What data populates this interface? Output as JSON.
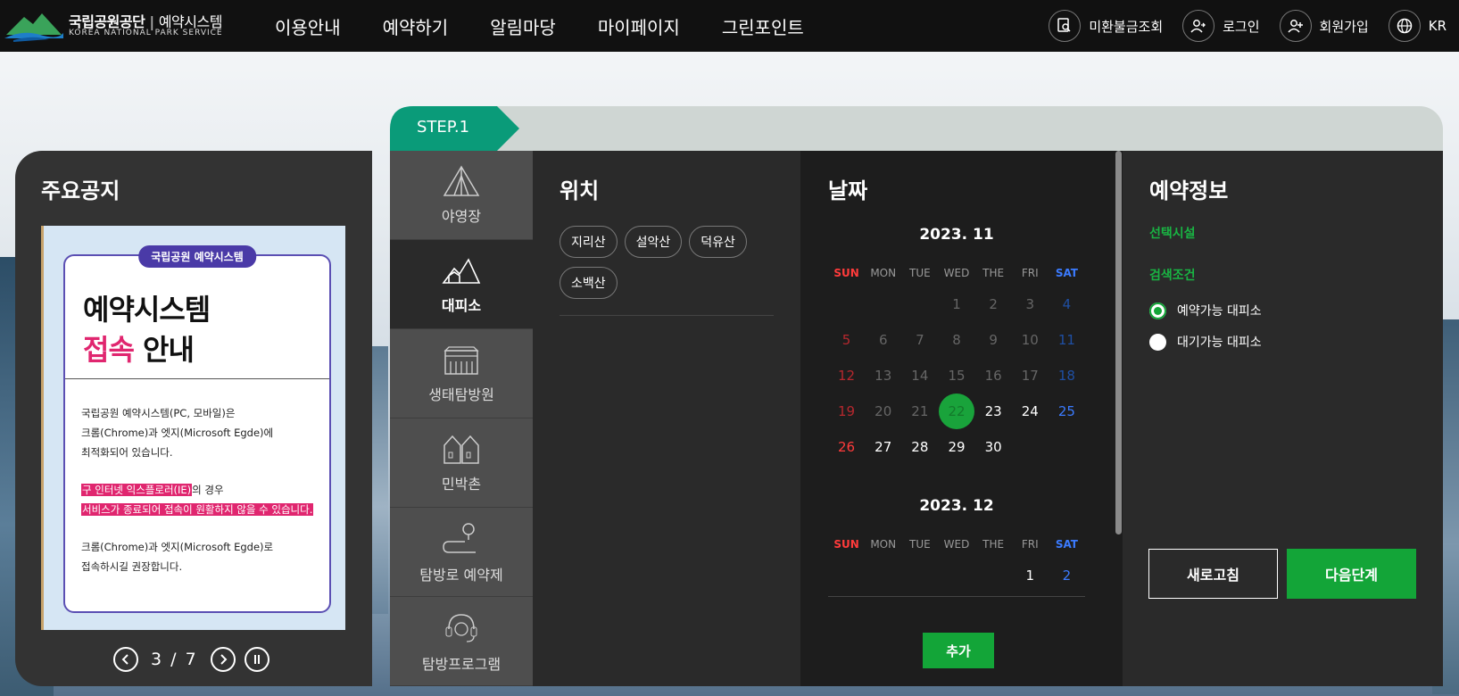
{
  "header": {
    "logo_kr": "국립공원공단",
    "logo_sub": "예약시스템",
    "logo_en": "KOREA NATIONAL PARK SERVICE",
    "nav": [
      "이용안내",
      "예약하기",
      "알림마당",
      "마이페이지",
      "그린포인트"
    ],
    "util": {
      "refund": "미환불금조회",
      "login": "로그인",
      "signup": "회원가입",
      "lang": "KR"
    }
  },
  "notice": {
    "title": "주요공지",
    "banner": {
      "pill": "국립공원 예약시스템",
      "headline1": "예약시스템",
      "headline2_pink": "접속",
      "headline2_rest": " 안내",
      "para1_line1": "국립공원 예약시스템(PC, 모바일)은",
      "para1_line2": "크롬(Chrome)과 엣지(Microsoft Egde)에",
      "para1_line3": "최적화되어 있습니다.",
      "para2_hl1": "구 인터넷 익스플로러(IE)",
      "para2_rest": "의 경우",
      "para2_hl2": "서비스가 종료되어 접속이 원활하지 않을 수 있습니다.",
      "para3_line1": "크롬(Chrome)과 엣지(Microsoft Egde)로",
      "para3_line2": "접속하시길 권장합니다."
    },
    "pager": {
      "current": "3",
      "sep": "/",
      "total": "7"
    }
  },
  "step": {
    "label": "STEP.1"
  },
  "categories": [
    {
      "label": "야영장",
      "icon": "tent-icon"
    },
    {
      "label": "대피소",
      "icon": "shelter-icon",
      "active": true
    },
    {
      "label": "생태탐방원",
      "icon": "building-icon"
    },
    {
      "label": "민박촌",
      "icon": "houses-icon"
    },
    {
      "label": "탐방로 예약제",
      "icon": "trail-pin-icon"
    },
    {
      "label": "탐방프로그램",
      "icon": "guide-headset-icon"
    }
  ],
  "location": {
    "title": "위치",
    "chips": [
      "지리산",
      "설악산",
      "덕유산",
      "소백산"
    ]
  },
  "date": {
    "title": "날짜",
    "dow": [
      "SUN",
      "MON",
      "TUE",
      "WED",
      "THE",
      "FRI",
      "SAT"
    ],
    "month1": {
      "label": "2023. 11",
      "offset": 3,
      "days": 30,
      "selected": 22,
      "available_from": 23
    },
    "month2": {
      "label": "2023. 12",
      "offset": 5,
      "visible_days": [
        1,
        2
      ],
      "available_from": 1
    },
    "add_button": "추가"
  },
  "info": {
    "title": "예약정보",
    "selected_facility_label": "선택시설",
    "search_condition_label": "검색조건",
    "radio1": "예약가능 대피소",
    "radio2": "대기가능 대피소",
    "refresh": "새로고침",
    "next": "다음단계"
  },
  "colors": {
    "accent_green": "#13a538",
    "step_teal": "#0a9b79",
    "pink": "#e0266f",
    "purple": "#4a3aa7"
  }
}
